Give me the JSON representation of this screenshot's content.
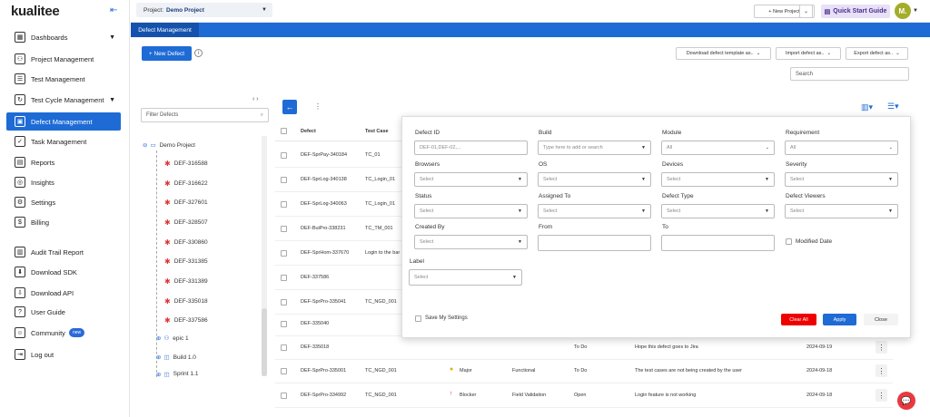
{
  "app": {
    "logo": "kualitee"
  },
  "sidebar": {
    "items": [
      {
        "label": "Dashboards",
        "icon": "dashboard-icon"
      },
      {
        "label": "Project Management",
        "icon": "project-icon"
      },
      {
        "label": "Test Management",
        "icon": "test-icon"
      },
      {
        "label": "Test Cycle Management",
        "icon": "cycle-icon"
      },
      {
        "label": "Defect Management",
        "icon": "defect-icon"
      },
      {
        "label": "Task Management",
        "icon": "task-icon"
      },
      {
        "label": "Reports",
        "icon": "reports-icon"
      },
      {
        "label": "Insights",
        "icon": "insights-icon"
      },
      {
        "label": "Settings",
        "icon": "settings-icon"
      },
      {
        "label": "Billing",
        "icon": "billing-icon"
      },
      {
        "label": "Audit Trail Report",
        "icon": "audit-icon"
      },
      {
        "label": "Download SDK",
        "icon": "sdk-icon"
      },
      {
        "label": "Download API",
        "icon": "api-icon"
      },
      {
        "label": "User Guide",
        "icon": "guide-icon"
      },
      {
        "label": "Community",
        "icon": "community-icon"
      },
      {
        "label": "Log out",
        "icon": "logout-icon"
      }
    ],
    "new_badge": "new"
  },
  "topbar": {
    "project_label": "Project:",
    "project_value": "Demo Project",
    "new_project": "+ New Project",
    "quick_start": "Quick Start Guide",
    "avatar": "M."
  },
  "tab": {
    "label": "Defect Management"
  },
  "toolbar": {
    "new_defect": "+ New Defect",
    "download_template": "Download defect template as..",
    "import_defect": "Import defect as..",
    "export_defect": "Export defect as..",
    "search_placeholder": "Search"
  },
  "tree": {
    "filter_placeholder": "Filter Defects",
    "root": "Demo Project",
    "defects": [
      "DEF-316588",
      "DEF-316622",
      "DEF-327601",
      "DEF-328507",
      "DEF-330860",
      "DEF-331385",
      "DEF-331389",
      "DEF-335018",
      "DEF-337586"
    ],
    "epic": "epic 1",
    "build": "Build 1.0",
    "partial": "Sprint 1.1"
  },
  "table": {
    "headers": {
      "defect": "Defect",
      "test_case": "Test Case"
    },
    "rows": [
      {
        "defect": "DEF-SprPay-340184",
        "tc": "TC_01",
        "sev": "",
        "mod": "",
        "status": "",
        "desc": "",
        "date": ""
      },
      {
        "defect": "DEF-SprLog-340138",
        "tc": "TC_Login_01",
        "sev": "",
        "mod": "",
        "status": "",
        "desc": "",
        "date": ""
      },
      {
        "defect": "DEF-SprLog-340063",
        "tc": "TC_Login_01",
        "sev": "",
        "mod": "",
        "status": "",
        "desc": "",
        "date": ""
      },
      {
        "defect": "DEF-BuiPro-338231",
        "tc": "TC_TM_001",
        "sev": "",
        "mod": "",
        "status": "",
        "desc": "",
        "date": ""
      },
      {
        "defect": "DEF-SprHom-337670",
        "tc": "Login to the bar",
        "sev": "",
        "mod": "",
        "status": "",
        "desc": "",
        "date": ""
      },
      {
        "defect": "DEF-337586",
        "tc": "",
        "sev": "",
        "mod": "",
        "status": "",
        "desc": "",
        "date": ""
      },
      {
        "defect": "DEF-SprPro-335041",
        "tc": "TC_NGD_001",
        "sev": "",
        "mod": "",
        "status": "",
        "desc": "",
        "date": ""
      },
      {
        "defect": "DEF-335040",
        "tc": "",
        "sev": "",
        "mod": "",
        "status": "",
        "desc": "",
        "date": ""
      },
      {
        "defect": "DEF-335018",
        "tc": "",
        "sev": "",
        "mod": "",
        "status": "To Do",
        "desc": "Hope this defect goes to Jira",
        "date": "2024-09-19"
      },
      {
        "defect": "DEF-SprPro-335001",
        "tc": "TC_NGD_001",
        "sev": "Major",
        "mod": "Functional",
        "status": "To Do",
        "desc": "The test cases are not being created by the user",
        "date": "2024-09-18"
      },
      {
        "defect": "DEF-SprPro-334992",
        "tc": "TC_NGD_001",
        "sev": "Blocker",
        "mod": "Field Validation",
        "status": "Open",
        "desc": "Login feature is not working",
        "date": "2024-09-18"
      }
    ]
  },
  "filter": {
    "defect_id": {
      "label": "Defect ID",
      "placeholder": "DEF-01,DEF-02,..."
    },
    "build": {
      "label": "Build",
      "placeholder": "Type here to add or search"
    },
    "module": {
      "label": "Module",
      "value": "All"
    },
    "requirement": {
      "label": "Requirement",
      "value": "All"
    },
    "browsers": {
      "label": "Browsers",
      "value": "Select"
    },
    "os": {
      "label": "OS",
      "value": "Select"
    },
    "devices": {
      "label": "Devices",
      "value": "Select"
    },
    "severity": {
      "label": "Severity",
      "value": "Select"
    },
    "status": {
      "label": "Status",
      "value": "Select"
    },
    "assigned_to": {
      "label": "Assigned To",
      "value": "Select"
    },
    "defect_type": {
      "label": "Defect Type",
      "value": "Select"
    },
    "defect_viewers": {
      "label": "Defect Viewers",
      "value": "Select"
    },
    "created_by": {
      "label": "Created By",
      "value": "Select"
    },
    "from": {
      "label": "From"
    },
    "to": {
      "label": "To"
    },
    "modified_date": "Modified Date",
    "label": {
      "label": "Label",
      "value": "Select"
    },
    "save_settings": "Save My Settings",
    "clear_all": "Clear All",
    "apply": "Apply",
    "close": "Close"
  }
}
